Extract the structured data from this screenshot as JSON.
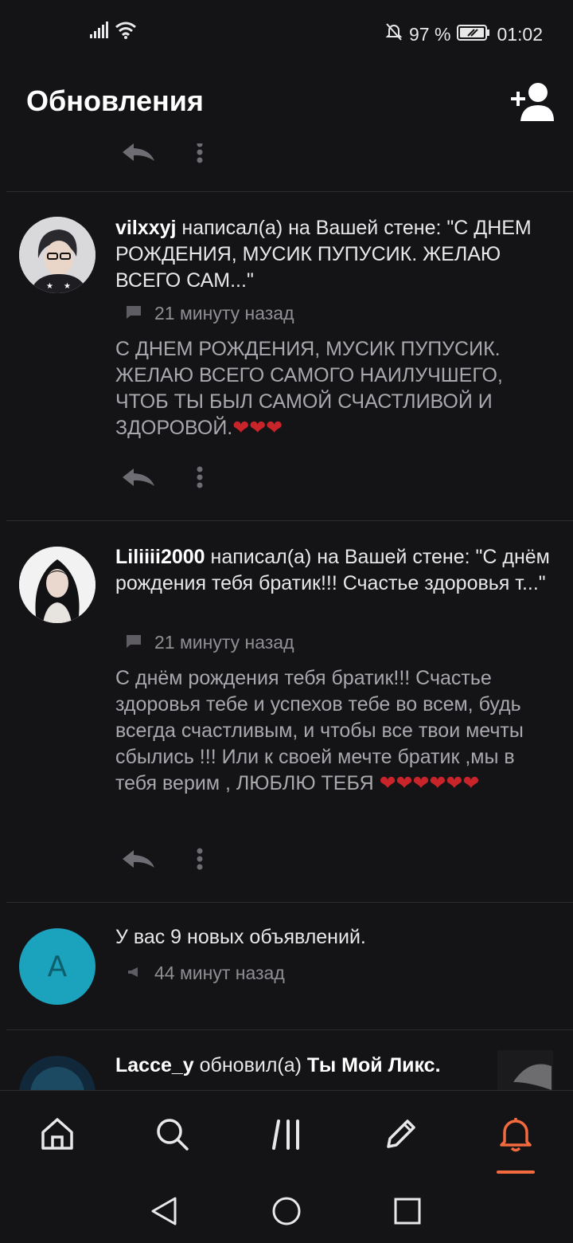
{
  "status_bar": {
    "battery": "97 %",
    "time": "01:02"
  },
  "header": {
    "title": "Обновления"
  },
  "feed": {
    "items": [
      {
        "user": "vilxxyj",
        "action": " написал(а) на Вашей стене: \"С ДНЕМ РОЖДЕНИЯ, МУСИК ПУПУСИК. ЖЕЛАЮ ВСЕГО САМ...\"",
        "time": "21 минуту назад",
        "text": "С ДНЕМ РОЖДЕНИЯ, МУСИК ПУПУСИК.  ЖЕЛАЮ ВСЕГО САМОГО НАИЛУЧШЕГО, ЧТОБ ТЫ БЫЛ САМОЙ СЧАСТЛИВОЙ И ЗДОРОВОЙ.",
        "hearts": "❤❤❤"
      },
      {
        "user": "Liliiii2000",
        "action": " написал(а) на Вашей стене: \"С днём рождения тебя братик!!! Счастье здоровья т...\"",
        "time": "21 минуту назад",
        "text": "С днём рождения тебя братик!!! Счастье здоровья тебе и успехов тебе во всем, будь всегда счастливым, и чтобы все твои мечты сбылись !!! Или к своей мечте братик ,мы в тебя верим , ЛЮБЛЮ ТЕБЯ ",
        "hearts": "❤❤❤❤❤❤"
      }
    ],
    "announcement": {
      "avatar_letter": "A",
      "text": "У вас 9 новых объявлений.",
      "time": "44 минут назад"
    },
    "partial": {
      "user": "Lacce_y",
      "action": " обновил(а) ",
      "target": "Ты Мой Ликс."
    }
  },
  "icons": {
    "add_friend": "add-user-icon",
    "comment": "comment-icon",
    "reply": "reply-icon",
    "more": "more-vertical-icon",
    "nav": [
      "home-icon",
      "search-icon",
      "feed-icon",
      "pencil-icon",
      "bell-icon"
    ]
  },
  "colors": {
    "background": "#141316",
    "accent": "#f26a3d",
    "heart": "#c8242a",
    "announcement_avatar": "#1ba3bd"
  }
}
